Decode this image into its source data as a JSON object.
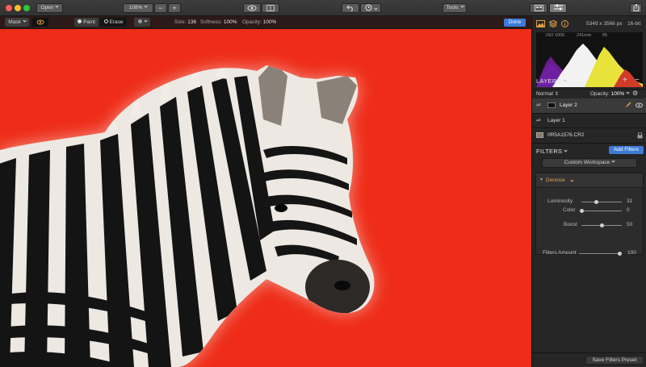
{
  "toolbar": {
    "open_label": "Open",
    "zoom_value": "108%",
    "zoom_out_glyph": "−",
    "zoom_in_glyph": "+",
    "tools_label": "Tools"
  },
  "maskbar": {
    "mask_label": "Mask",
    "paint_label": "Paint",
    "erase_label": "Erase",
    "size_label": "Size:",
    "size_value": "136",
    "softness_label": "Softness:",
    "softness_value": "100%",
    "opacity_label": "Opacity:",
    "opacity_value": "100%",
    "done_label": "Done"
  },
  "info": {
    "dimensions": "5349 x 3566 px",
    "bit_depth": "16-bit",
    "iso": "ISO 1000",
    "focal": "241mm",
    "aperture": "f/5"
  },
  "layers": {
    "title": "LAYERS",
    "blend_mode": "Normal",
    "opacity_label": "Opacity:",
    "opacity_value": "100%",
    "add_glyph": "+",
    "remove_glyph": "−",
    "items": [
      {
        "name": "Layer 2"
      },
      {
        "name": "Layer 1"
      },
      {
        "name": "0R5A1576.CR2"
      }
    ]
  },
  "filters": {
    "title": "FILTERS",
    "add_label": "Add Filters",
    "workspace_label": "Custom Workspace",
    "filter_name": "Denoise",
    "sliders": [
      {
        "label": "Luminosity",
        "value": 31,
        "max": 100
      },
      {
        "label": "Color",
        "value": 0,
        "max": 100
      },
      {
        "label": "Boost",
        "value": 50,
        "max": 100
      }
    ],
    "amount_label": "Filters Amount",
    "amount_value": 100,
    "save_preset_label": "Save Filters Preset"
  },
  "colors": {
    "canvas_background": "#ee2c17",
    "accent_blue": "#3c7bd6",
    "filter_name": "#e0a347"
  }
}
